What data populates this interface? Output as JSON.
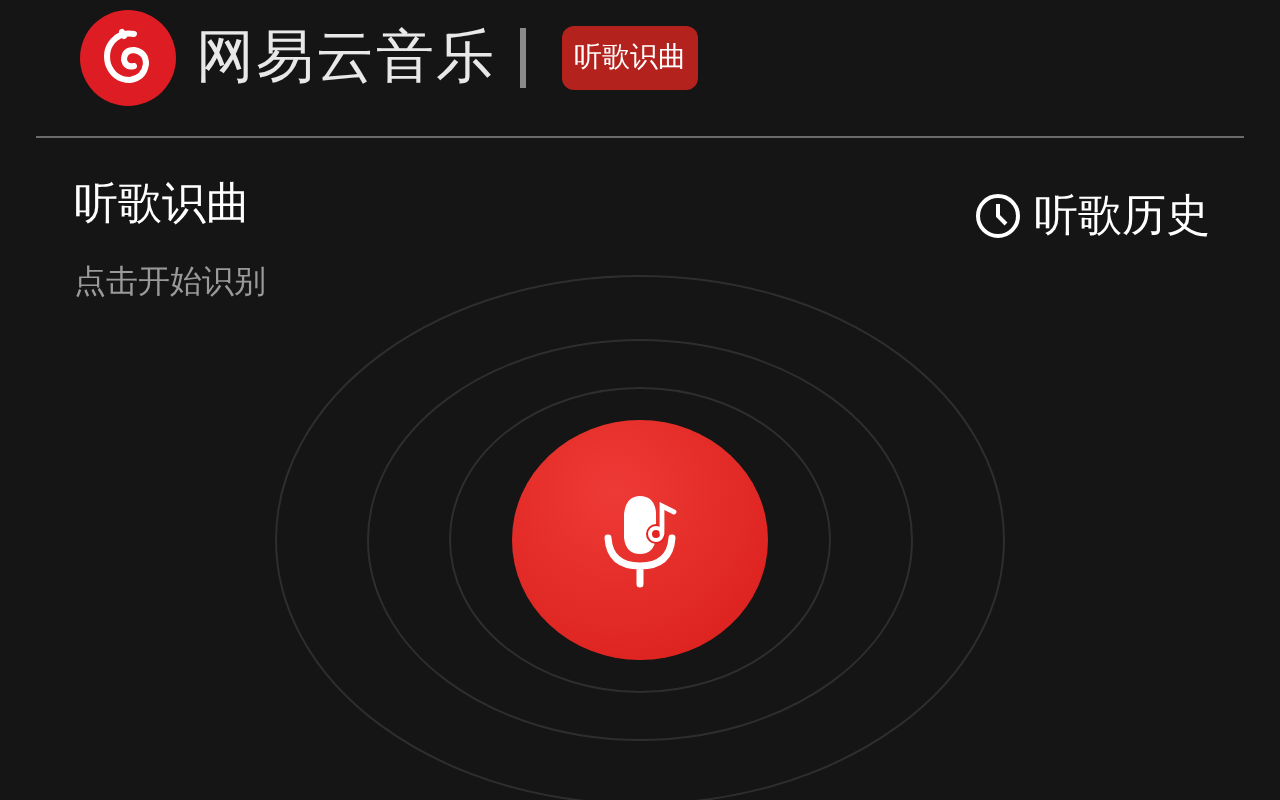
{
  "header": {
    "brand": "网易云音乐",
    "badge": "听歌识曲"
  },
  "page": {
    "title": "听歌识曲",
    "subtitle": "点击开始识别",
    "history_link": "听歌历史"
  }
}
